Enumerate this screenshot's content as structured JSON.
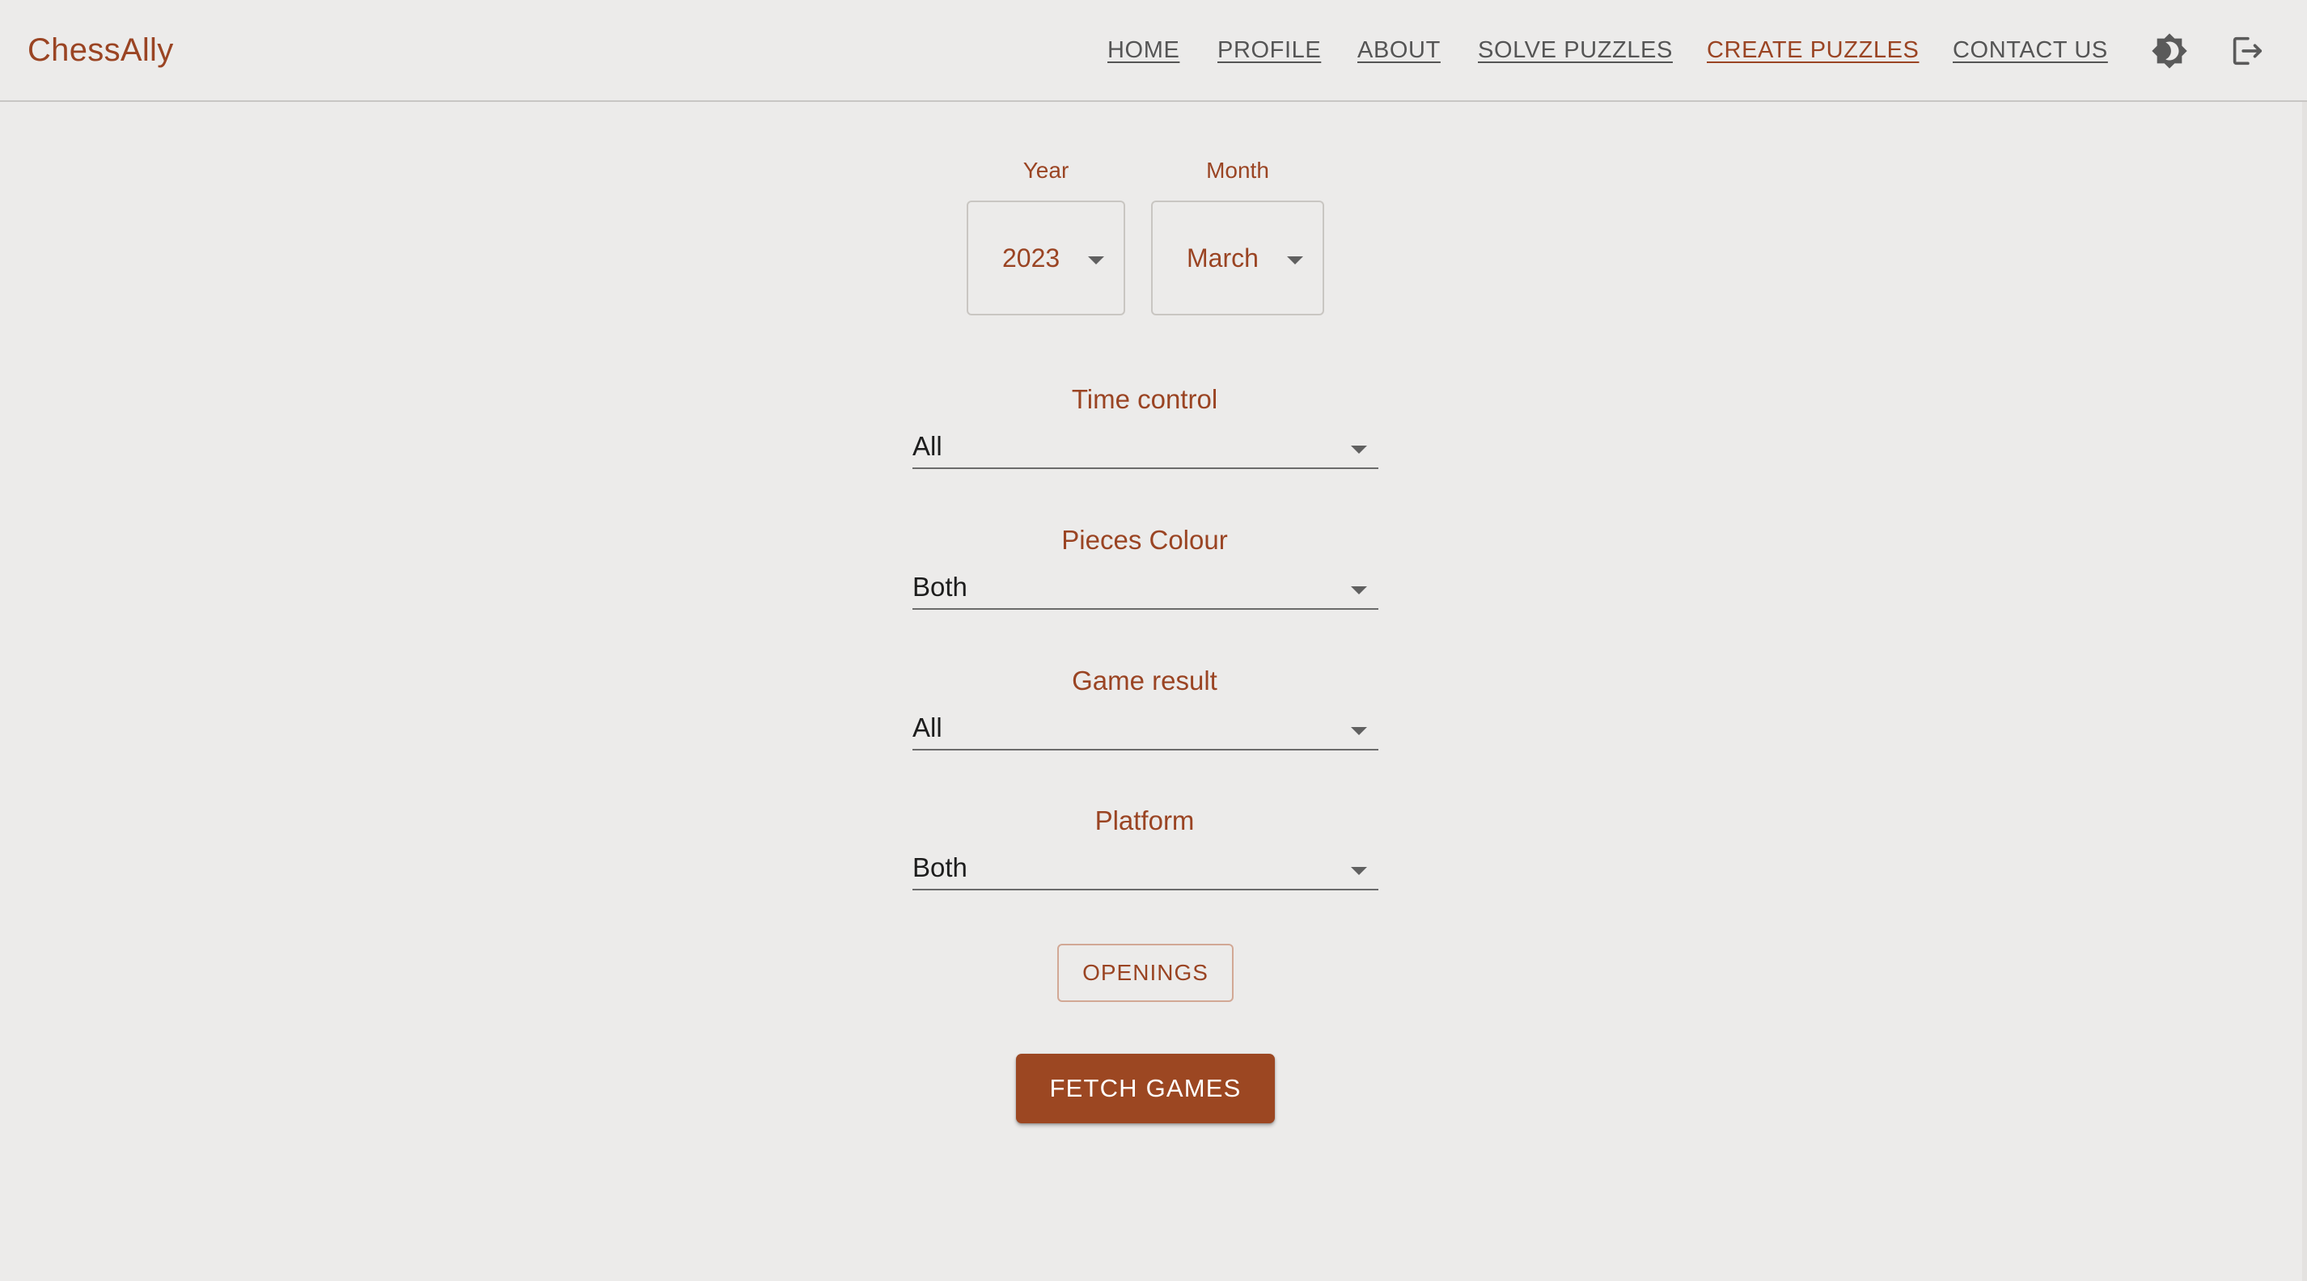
{
  "app": {
    "brand": "ChessAlly"
  },
  "nav": {
    "items": [
      {
        "label": "HOME"
      },
      {
        "label": "PROFILE"
      },
      {
        "label": "ABOUT"
      },
      {
        "label": "SOLVE PUZZLES"
      },
      {
        "label": "CREATE PUZZLES",
        "active": true
      },
      {
        "label": "CONTACT US"
      }
    ],
    "icons": [
      "theme-toggle-icon",
      "logout-icon"
    ]
  },
  "filters": {
    "year": {
      "label": "Year",
      "value": "2023"
    },
    "month": {
      "label": "Month",
      "value": "March"
    },
    "time_control": {
      "label": "Time control",
      "value": "All"
    },
    "pieces_colour": {
      "label": "Pieces Colour",
      "value": "Both"
    },
    "game_result": {
      "label": "Game result",
      "value": "All"
    },
    "platform": {
      "label": "Platform",
      "value": "Both"
    }
  },
  "actions": {
    "openings_label": "OPENINGS",
    "fetch_label": "FETCH GAMES"
  },
  "colors": {
    "accent": "#9a4423",
    "background": "#ecebea",
    "text": "#1d1d1d",
    "nav_text": "#555555"
  }
}
